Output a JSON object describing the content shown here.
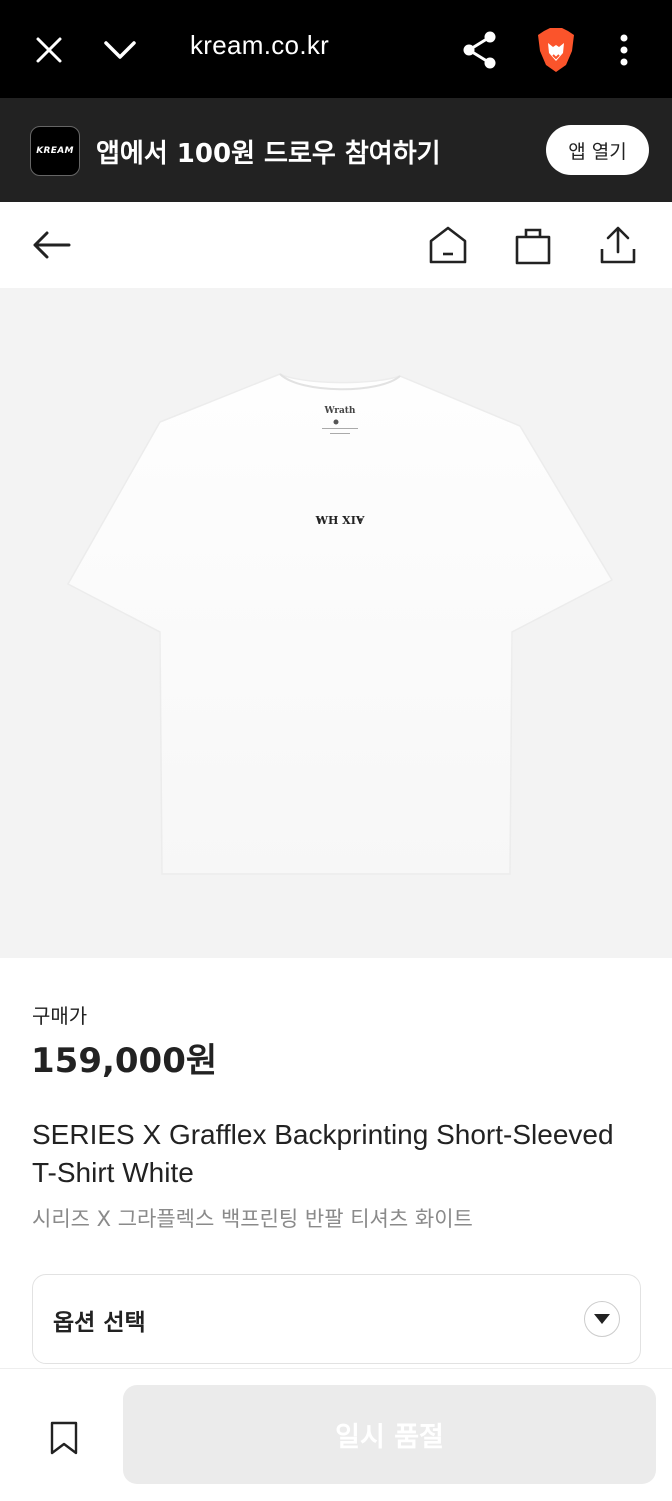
{
  "browser": {
    "url": "kream.co.kr"
  },
  "app_banner": {
    "logo_text": "KREAM",
    "text": "앱에서 100원 드로우 참여하기",
    "open_button": "앱 열기"
  },
  "product": {
    "print_text": "WH XIV",
    "price_label": "구매가",
    "price": "159,000원",
    "name_en": "SERIES X Grafflex Backprinting Short-Sleeved T-Shirt White",
    "name_ko": "시리즈 X 그라플렉스 백프린팅 반팔 티셔츠 화이트"
  },
  "option": {
    "label": "옵션 선택"
  },
  "bottom": {
    "buy_button": "일시 품절"
  },
  "icons": [
    "close-icon",
    "chevron-down-icon",
    "share-icon",
    "brave-lion-icon",
    "more-vertical-icon",
    "back-arrow-icon",
    "home-icon",
    "shopping-bag-icon",
    "upload-share-icon",
    "dropdown-triangle-icon",
    "bookmark-icon"
  ],
  "colors": {
    "browser_bg": "#000000",
    "banner_bg": "#222222",
    "hero_bg": "#f3f3f3",
    "disabled_button": "#ebebeb",
    "brave_orange": "#fb542b"
  }
}
